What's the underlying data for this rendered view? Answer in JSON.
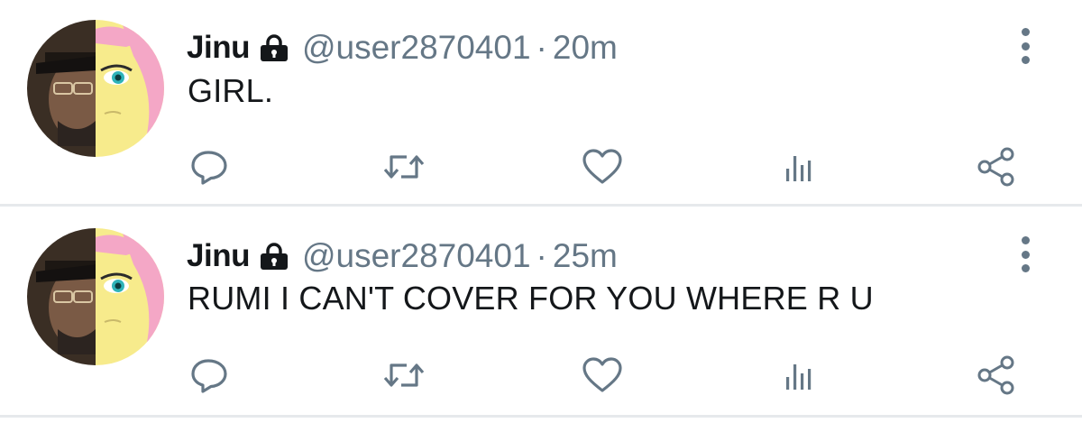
{
  "tweets": [
    {
      "display_name": "Jinu",
      "handle": "@user2870401",
      "separator": "·",
      "time": "20m",
      "text": "GIRL.",
      "protected_icon": "lock-icon",
      "avatar": "avatar-image"
    },
    {
      "display_name": "Jinu",
      "handle": "@user2870401",
      "separator": "·",
      "time": "25m",
      "text": "RUMI I CAN'T COVER FOR YOU WHERE R U",
      "protected_icon": "lock-icon",
      "avatar": "avatar-image"
    }
  ],
  "action_icons": [
    "reply-icon",
    "retweet-icon",
    "like-icon",
    "analytics-icon",
    "share-icon"
  ],
  "more_icon": "more-vertical-icon",
  "colors": {
    "text_primary": "#14171a",
    "text_secondary": "#657786",
    "divider": "#e6e9ec"
  }
}
